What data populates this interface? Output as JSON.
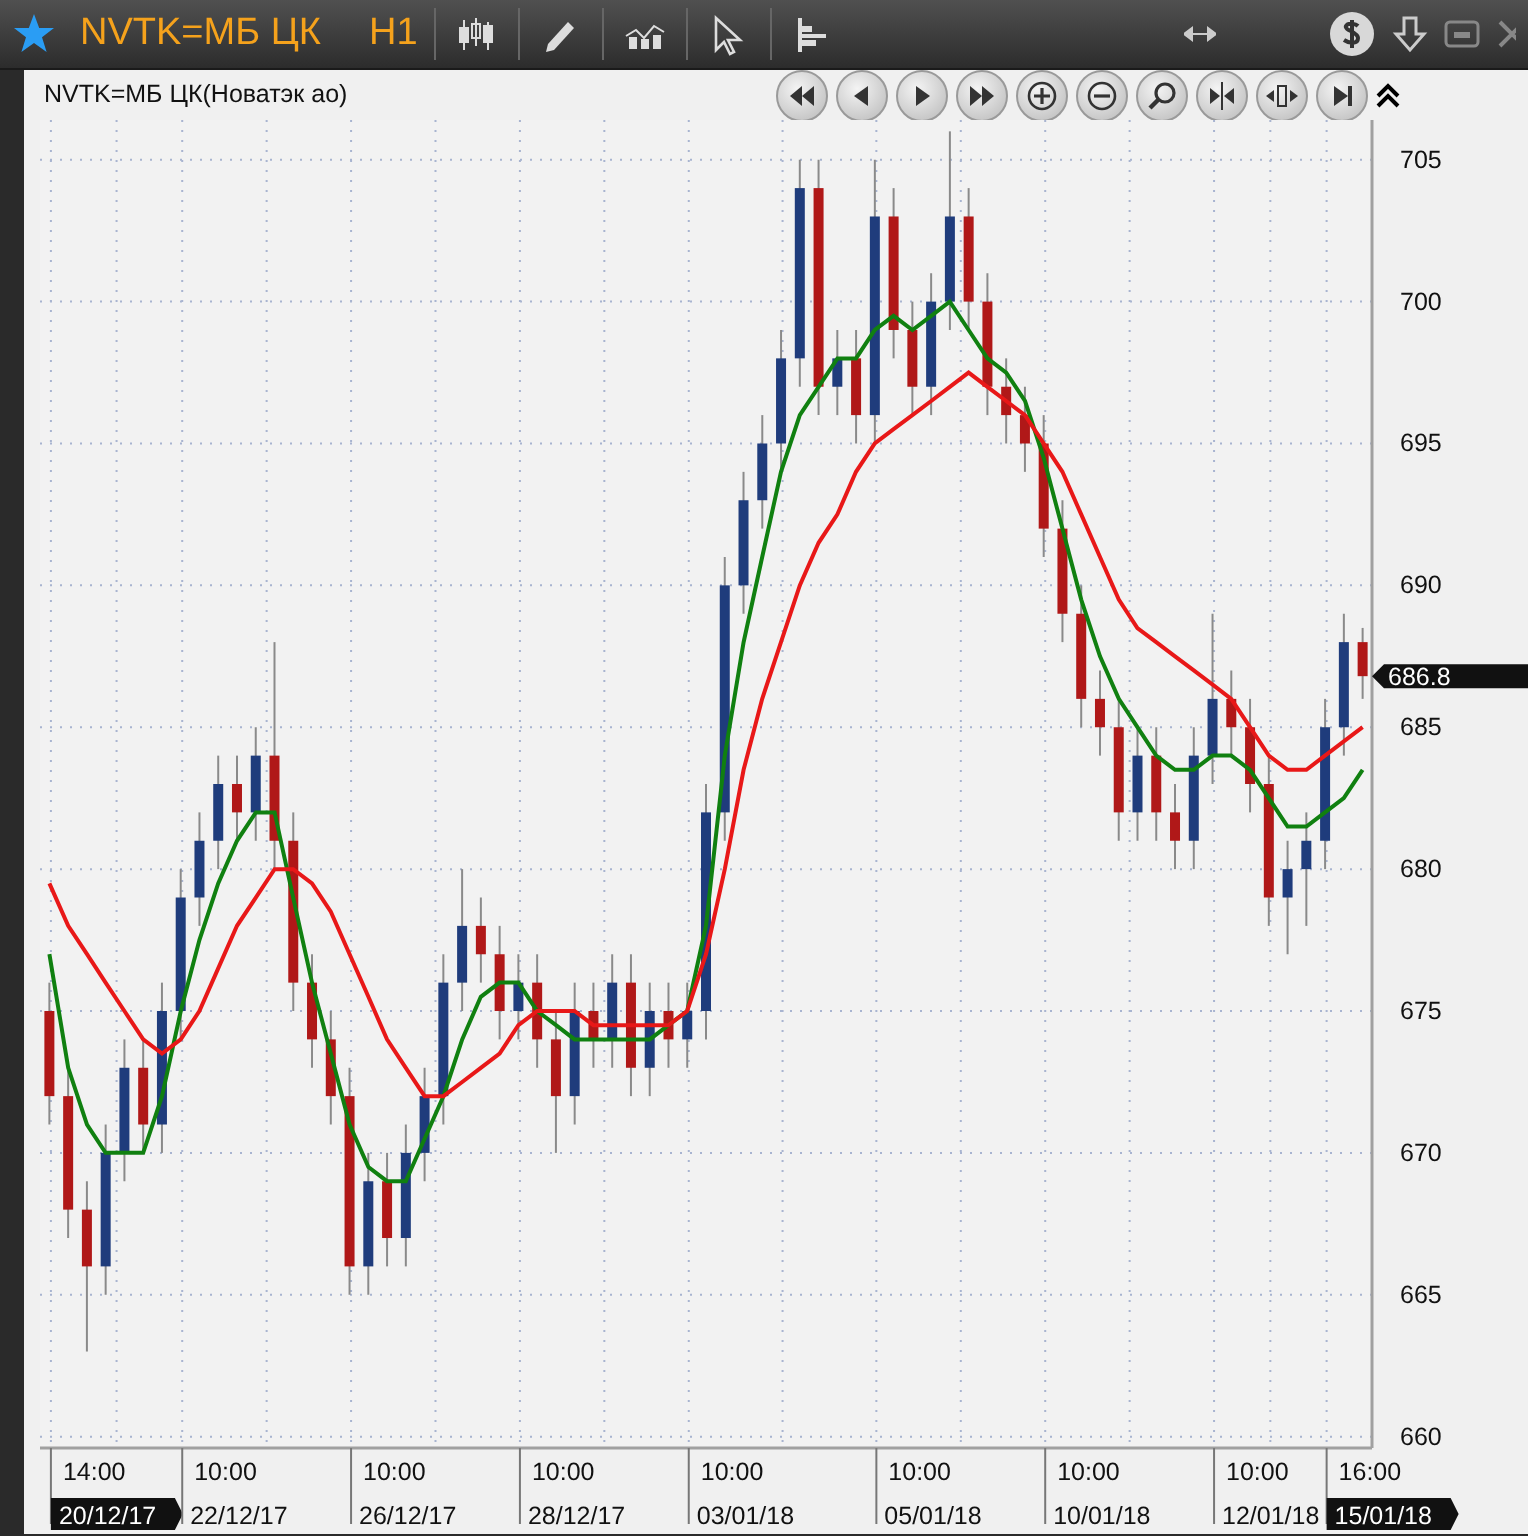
{
  "window": {
    "symbol": "NVTK=МБ ЦК",
    "timeframe": "H1"
  },
  "chart": {
    "title": "NVTK=МБ ЦК(Новатэк ао)",
    "last_price": "686.8",
    "date_labels": [
      {
        "text": "20/12/17",
        "highlighted": true
      },
      {
        "text": "22/12/17",
        "highlighted": false
      },
      {
        "text": "26/12/17",
        "highlighted": false
      },
      {
        "text": "28/12/17",
        "highlighted": false
      },
      {
        "text": "03/01/18",
        "highlighted": false
      },
      {
        "text": "05/01/18",
        "highlighted": false
      },
      {
        "text": "10/01/18",
        "highlighted": false
      },
      {
        "text": "12/01/18",
        "highlighted": false
      },
      {
        "text": "15/01/18",
        "highlighted": true
      }
    ],
    "chart_data": {
      "type": "candlestick",
      "grid": true,
      "ylim": [
        659.6,
        706.4
      ],
      "yticks": [
        660,
        665,
        670,
        675,
        680,
        685,
        690,
        695,
        700,
        705
      ],
      "categories": [
        null,
        null,
        "14:00",
        null,
        null,
        null,
        null,
        null,
        null,
        "10:00",
        null,
        null,
        null,
        null,
        null,
        null,
        null,
        null,
        "10:00",
        null,
        null,
        null,
        null,
        null,
        null,
        null,
        null,
        "10:00",
        null,
        null,
        null,
        null,
        null,
        null,
        null,
        null,
        "10:00",
        null,
        null,
        null,
        null,
        null,
        null,
        null,
        null,
        null,
        "10:00",
        null,
        null,
        null,
        null,
        null,
        null,
        null,
        null,
        "10:00",
        null,
        null,
        null,
        null,
        null,
        null,
        null,
        null,
        "10:00",
        null,
        null,
        null,
        null,
        null,
        "16:00"
      ],
      "ohlc": [
        [
          675,
          676,
          671,
          672
        ],
        [
          672,
          673,
          667,
          668
        ],
        [
          668,
          669,
          663,
          666
        ],
        [
          666,
          671,
          665,
          670
        ],
        [
          670,
          674,
          669,
          673
        ],
        [
          673,
          674,
          670,
          671
        ],
        [
          671,
          676,
          670,
          675
        ],
        [
          675,
          680,
          674,
          679
        ],
        [
          679,
          682,
          678,
          681
        ],
        [
          681,
          684,
          680,
          683
        ],
        [
          683,
          684,
          681,
          682
        ],
        [
          682,
          685,
          681,
          684
        ],
        [
          684,
          688,
          680,
          681
        ],
        [
          681,
          682,
          675,
          676
        ],
        [
          676,
          677,
          673,
          674
        ],
        [
          674,
          675,
          671,
          672
        ],
        [
          672,
          673,
          665,
          666
        ],
        [
          666,
          670,
          665,
          669
        ],
        [
          669,
          670,
          666,
          667
        ],
        [
          667,
          671,
          666,
          670
        ],
        [
          670,
          673,
          669,
          672
        ],
        [
          672,
          677,
          671,
          676
        ],
        [
          676,
          680,
          675,
          678
        ],
        [
          678,
          679,
          676,
          677
        ],
        [
          677,
          678,
          674,
          675
        ],
        [
          675,
          677,
          674,
          676
        ],
        [
          676,
          677,
          673,
          674
        ],
        [
          674,
          675,
          670,
          672
        ],
        [
          672,
          676,
          671,
          675
        ],
        [
          675,
          676,
          673,
          674
        ],
        [
          674,
          677,
          673,
          676
        ],
        [
          676,
          677,
          672,
          673
        ],
        [
          673,
          676,
          672,
          675
        ],
        [
          675,
          676,
          673,
          674
        ],
        [
          674,
          676,
          673,
          675
        ],
        [
          675,
          683,
          674,
          682
        ],
        [
          682,
          691,
          681,
          690
        ],
        [
          690,
          694,
          689,
          693
        ],
        [
          693,
          696,
          692,
          695
        ],
        [
          695,
          699,
          694,
          698
        ],
        [
          698,
          705,
          697,
          704
        ],
        [
          704,
          705,
          696,
          697
        ],
        [
          697,
          699,
          696,
          698
        ],
        [
          698,
          699,
          695,
          696
        ],
        [
          696,
          705,
          695,
          703
        ],
        [
          703,
          704,
          698,
          699
        ],
        [
          699,
          700,
          696,
          697
        ],
        [
          697,
          701,
          696,
          700
        ],
        [
          700,
          706,
          699,
          703
        ],
        [
          703,
          704,
          699,
          700
        ],
        [
          700,
          701,
          696,
          697
        ],
        [
          697,
          698,
          695,
          696
        ],
        [
          696,
          697,
          694,
          695
        ],
        [
          695,
          696,
          691,
          692
        ],
        [
          692,
          693,
          688,
          689
        ],
        [
          689,
          690,
          685,
          686
        ],
        [
          686,
          687,
          684,
          685
        ],
        [
          685,
          686,
          681,
          682
        ],
        [
          682,
          685,
          681,
          684
        ],
        [
          684,
          685,
          681,
          682
        ],
        [
          682,
          683,
          680,
          681
        ],
        [
          681,
          685,
          680,
          684
        ],
        [
          684,
          689,
          683,
          686
        ],
        [
          686,
          687,
          684,
          685
        ],
        [
          685,
          686,
          682,
          683
        ],
        [
          683,
          684,
          678,
          679
        ],
        [
          679,
          681,
          677,
          680
        ],
        [
          680,
          682,
          678,
          681
        ],
        [
          681,
          686,
          680,
          685
        ],
        [
          685,
          689,
          684,
          688
        ],
        [
          688,
          688.5,
          686,
          686.8
        ]
      ],
      "series": [
        {
          "type": "line",
          "color": "#108010",
          "values": [
            677,
            673,
            671,
            670,
            670,
            670,
            672,
            675,
            677.5,
            679.5,
            681,
            682,
            682,
            679,
            676,
            673.5,
            671,
            669.5,
            669,
            669,
            670.5,
            672,
            674,
            675.5,
            676,
            676,
            675,
            674.5,
            674,
            674,
            674,
            674,
            674,
            674.5,
            675,
            678,
            684,
            688,
            691,
            694,
            696,
            697,
            698,
            698,
            699,
            699.5,
            699,
            699.5,
            700,
            699,
            698,
            697.5,
            696.5,
            694.5,
            692,
            689.5,
            687.5,
            686,
            685,
            684,
            683.5,
            683.5,
            684,
            684,
            683.5,
            682.5,
            681.5,
            681.5,
            682,
            682.5,
            683.5
          ]
        },
        {
          "type": "line",
          "color": "#e81818",
          "values": [
            679.5,
            678,
            677,
            676,
            675,
            674,
            673.5,
            674,
            675,
            676.5,
            678,
            679,
            680,
            680,
            679.5,
            678.5,
            677,
            675.5,
            674,
            673,
            672,
            672,
            672.5,
            673,
            673.5,
            674.5,
            675,
            675,
            675,
            674.5,
            674.5,
            674.5,
            674.5,
            674.5,
            675,
            677,
            680,
            683.5,
            686,
            688,
            690,
            691.5,
            692.5,
            694,
            695,
            695.5,
            696,
            696.5,
            697,
            697.5,
            697,
            696.5,
            696,
            695,
            694,
            692.5,
            691,
            689.5,
            688.5,
            688,
            687.5,
            687,
            686.5,
            686,
            685,
            684,
            683.5,
            683.5,
            684,
            684.5,
            685
          ]
        }
      ]
    }
  }
}
